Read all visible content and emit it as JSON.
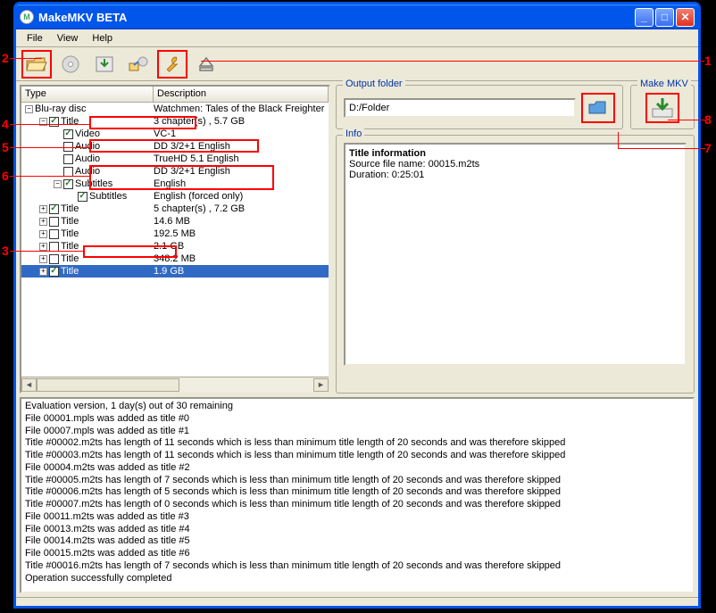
{
  "window": {
    "title": "MakeMKV BETA"
  },
  "menu": {
    "file": "File",
    "view": "View",
    "help": "Help"
  },
  "tree": {
    "headers": {
      "type": "Type",
      "desc": "Description"
    },
    "rows": [
      {
        "indent": 0,
        "exp": "-",
        "chk": "",
        "type": "Blu-ray disc",
        "desc": "Watchmen: Tales of the Black Freighter"
      },
      {
        "indent": 1,
        "exp": "-",
        "chk": "on",
        "type": "Title",
        "desc": "3 chapter(s) , 5.7 GB"
      },
      {
        "indent": 2,
        "exp": "",
        "chk": "on",
        "type": "Video",
        "desc": "VC-1"
      },
      {
        "indent": 2,
        "exp": "",
        "chk": "off",
        "type": "Audio",
        "desc": "DD 3/2+1 English"
      },
      {
        "indent": 2,
        "exp": "",
        "chk": "off",
        "type": "Audio",
        "desc": "TrueHD 5.1 English"
      },
      {
        "indent": 2,
        "exp": "",
        "chk": "off",
        "type": "Audio",
        "desc": "DD 3/2+1 English"
      },
      {
        "indent": 2,
        "exp": "-",
        "chk": "on",
        "type": "Subtitles",
        "desc": "English"
      },
      {
        "indent": 3,
        "exp": "",
        "chk": "on",
        "type": "Subtitles",
        "desc": "English  (forced only)"
      },
      {
        "indent": 1,
        "exp": "+",
        "chk": "on",
        "type": "Title",
        "desc": "5 chapter(s) , 7.2 GB"
      },
      {
        "indent": 1,
        "exp": "+",
        "chk": "off",
        "type": "Title",
        "desc": "14.6 MB"
      },
      {
        "indent": 1,
        "exp": "+",
        "chk": "off",
        "type": "Title",
        "desc": "192.5 MB"
      },
      {
        "indent": 1,
        "exp": "+",
        "chk": "off",
        "type": "Title",
        "desc": "2.1 GB"
      },
      {
        "indent": 1,
        "exp": "+",
        "chk": "off",
        "type": "Title",
        "desc": "348.2 MB"
      },
      {
        "indent": 1,
        "exp": "+",
        "chk": "on",
        "type": "Title",
        "desc": "1.9 GB",
        "selected": true
      }
    ]
  },
  "output": {
    "legend": "Output folder",
    "path": "D:/Folder"
  },
  "makemkv": {
    "legend": "Make MKV"
  },
  "info": {
    "legend": "Info",
    "title": "Title information",
    "line1": "Source file name: 00015.m2ts",
    "line2": "Duration: 0:25:01"
  },
  "log": [
    "Evaluation version, 1 day(s) out of 30 remaining",
    "File 00001.mpls was added as title #0",
    "File 00007.mpls was added as title #1",
    "Title #00002.m2ts has length of 11 seconds which is less than minimum title length of 20 seconds and was therefore skipped",
    "Title #00003.m2ts has length of 11 seconds which is less than minimum title length of 20 seconds and was therefore skipped",
    "File 00004.m2ts was added as title #2",
    "Title #00005.m2ts has length of 7 seconds which is less than minimum title length of 20 seconds and was therefore skipped",
    "Title #00006.m2ts has length of 5 seconds which is less than minimum title length of 20 seconds and was therefore skipped",
    "Title #00007.m2ts has length of 0 seconds which is less than minimum title length of 20 seconds and was therefore skipped",
    "File 00011.m2ts was added as title #3",
    "File 00013.m2ts was added as title #4",
    "File 00014.m2ts was added as title #5",
    "File 00015.m2ts was added as title #6",
    "Title #00016.m2ts has length of 7 seconds which is less than minimum title length of 20 seconds and was therefore skipped",
    "Operation successfully completed"
  ],
  "annotations": {
    "1": "1",
    "2": "2",
    "3": "3",
    "4": "4",
    "5": "5",
    "6": "6",
    "7": "7",
    "8": "8"
  }
}
